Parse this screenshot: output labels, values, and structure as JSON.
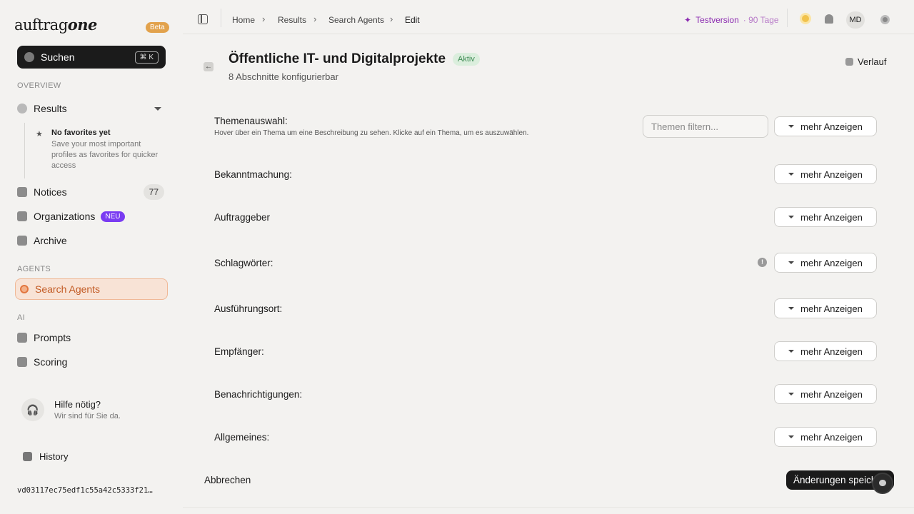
{
  "app": {
    "logo_left": "auftrag",
    "logo_right": "one",
    "beta": "Beta"
  },
  "search": {
    "label": "Suchen",
    "shortcut": "⌘ K"
  },
  "sidebar": {
    "overview_label": "OVERVIEW",
    "results": "Results",
    "favorites_title": "No favorites yet",
    "favorites_desc": "Save your most important profiles as favorites for quicker access",
    "notices": "Notices",
    "notices_count": "77",
    "organizations": "Organizations",
    "organizations_badge": "NEU",
    "archive": "Archive",
    "agents_label": "AGENTS",
    "search_agents": "Search Agents",
    "ai_label": "AI",
    "prompts": "Prompts",
    "scoring": "Scoring",
    "help_title": "Hilfe nötig?",
    "help_sub": "Wir sind für Sie da.",
    "history": "History",
    "hash": "vd03117ec75edf1c55a42c5333f21…"
  },
  "breadcrumb": [
    "Home",
    "Results",
    "Search Agents",
    "Edit"
  ],
  "header": {
    "trial": "Testversion",
    "trial_days": "90 Tage",
    "avatar": "MD"
  },
  "page": {
    "title": "Öffentliche IT- und Digitalprojekte",
    "status": "Aktiv",
    "subtitle": "8 Abschnitte konfigurierbar",
    "history_button": "Verlauf"
  },
  "sections": {
    "themen_label": "Themenauswahl:",
    "themen_desc": "Hover über ein Thema um eine Beschreibung zu sehen. Klicke auf ein Thema, um es auszuwählen.",
    "themen_placeholder": "Themen filtern...",
    "bekanntmachung": "Bekanntmachung:",
    "auftraggeber": "Auftraggeber",
    "schlagwoerter": "Schlagwörter:",
    "ausfuehrungsort": "Ausführungsort:",
    "empfaenger": "Empfänger:",
    "benachrichtigungen": "Benachrichtigungen:",
    "allgemeines": "Allgemeines:",
    "more_label": "mehr Anzeigen"
  },
  "footer": {
    "cancel": "Abbrechen",
    "save": "Änderungen speich"
  },
  "colors": {
    "accent_orange": "#c25a23",
    "trial_purple": "#8b2bb0",
    "neu_purple": "#7a3cf2",
    "beta_orange": "#e2a24c",
    "aktiv_green": "#3f8c55"
  }
}
